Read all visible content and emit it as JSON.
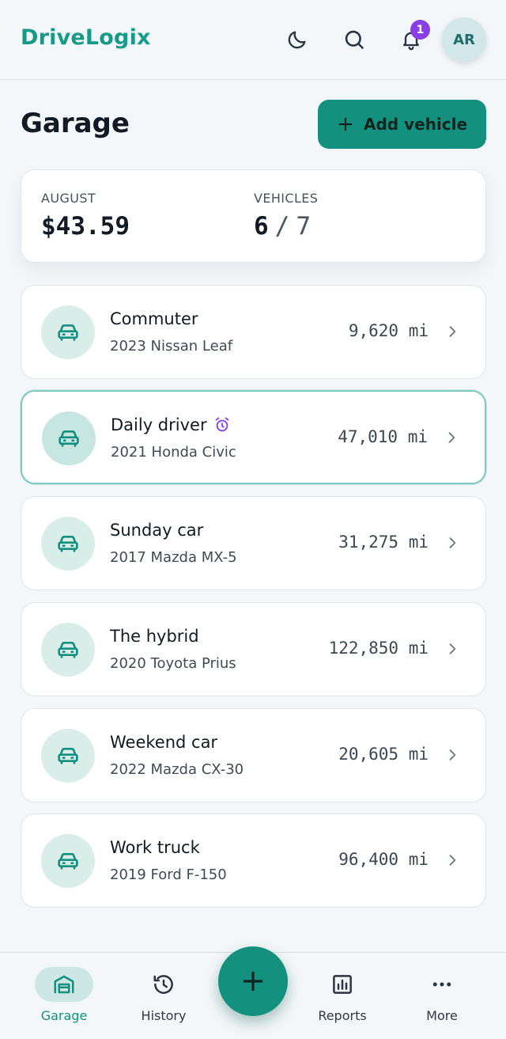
{
  "app": {
    "brand": "DriveLogix",
    "notification_count": "1",
    "avatar_initials": "AR",
    "accent_color": "#14907f",
    "badge_color": "#8a3ee6"
  },
  "header_icons": [
    "moon-icon",
    "search-icon",
    "bell-icon"
  ],
  "page": {
    "title": "Garage",
    "add_button_label": "Add vehicle"
  },
  "summary": {
    "month_label": "AUGUST",
    "month_value": "$43.59",
    "vehicles_label": "VEHICLES",
    "vehicles_active": "6",
    "vehicles_separator": "/",
    "vehicles_total": "7"
  },
  "vehicles": [
    {
      "name": "Commuter",
      "model": "2023 Nissan Leaf",
      "miles": "9,620 mi",
      "reminder": false,
      "selected": false
    },
    {
      "name": "Daily driver",
      "model": "2021 Honda Civic",
      "miles": "47,010 mi",
      "reminder": true,
      "selected": true
    },
    {
      "name": "Sunday car",
      "model": "2017 Mazda MX-5",
      "miles": "31,275 mi",
      "reminder": false,
      "selected": false
    },
    {
      "name": "The hybrid",
      "model": "2020 Toyota Prius",
      "miles": "122,850 mi",
      "reminder": false,
      "selected": false
    },
    {
      "name": "Weekend car",
      "model": "2022 Mazda CX-30",
      "miles": "20,605 mi",
      "reminder": false,
      "selected": false
    },
    {
      "name": "Work truck",
      "model": "2019 Ford F-150",
      "miles": "96,400 mi",
      "reminder": false,
      "selected": false
    }
  ],
  "nav": {
    "items": [
      {
        "label": "Garage",
        "icon": "garage-icon",
        "active": true
      },
      {
        "label": "History",
        "icon": "history-icon",
        "active": false
      },
      {
        "label": "Reports",
        "icon": "reports-icon",
        "active": false
      },
      {
        "label": "More",
        "icon": "more-icon",
        "active": false
      }
    ],
    "fab_icon": "plus-icon"
  }
}
